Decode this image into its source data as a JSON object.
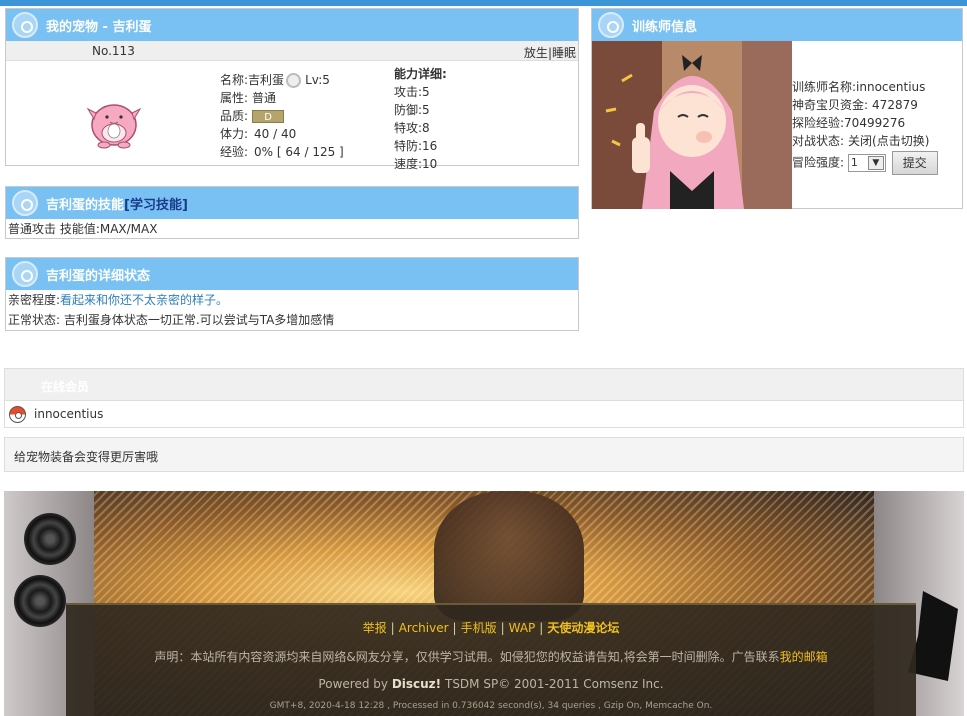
{
  "pet_panel": {
    "title": "我的宠物 - 吉利蛋",
    "number": "No.113",
    "release_label": "放生",
    "sleep_label": "睡眠",
    "separator": "|",
    "name_label": "名称:",
    "name_value": "吉利蛋",
    "level": "Lv:5",
    "type_label": "属性:",
    "type_value": "普通",
    "quality_label": "品质:",
    "quality_value": "D",
    "hp_label": "体力:",
    "hp_value": "40 / 40",
    "exp_label": "经验:",
    "exp_value": "0% [ 64 / 125 ]",
    "ability_title": "能力详细:",
    "stats": [
      "攻击:5",
      "防御:5",
      "特攻:8",
      "特防:16",
      "速度:10"
    ]
  },
  "skills_panel": {
    "title_prefix": "吉利蛋的技能",
    "learn_link": "[学习技能]",
    "content": "普通攻击 技能值:MAX/MAX"
  },
  "status_panel": {
    "title": "吉利蛋的详细状态",
    "intimacy_label": "亲密程度:",
    "intimacy_value": "看起来和你还不太亲密的样子。",
    "normal_label": "正常状态:",
    "normal_value": "吉利蛋身体状态一切正常.可以尝试与TA多增加感情"
  },
  "trainer_panel": {
    "title": "训练师信息",
    "name_label": "训练师名称:",
    "name_value": "innocentius",
    "money_label": "神奇宝贝资金:",
    "money_value": "472879",
    "exp_label": "探险经验:",
    "exp_value": "70499276",
    "battle_label": "对战状态:",
    "battle_value": "关闭(点击切换)",
    "difficulty_label": "冒险强度:",
    "difficulty_selected": "1",
    "submit_label": "提交"
  },
  "online_panel": {
    "title": "在线会员",
    "users": [
      "innocentius"
    ]
  },
  "tip": "给宠物装备会变得更厉害哦",
  "footer": {
    "links": [
      "举报",
      "Archiver",
      "手机版",
      "WAP"
    ],
    "forum_name": "天使动漫论坛",
    "declaration": "声明：本站所有内容资源均来自网络&网友分享，仅供学习试用。如侵犯您的权益请告知,将会第一时间删除。广告联系",
    "mail_link": "我的邮箱",
    "powered_prefix": "Powered by",
    "powered_brand": "Discuz!",
    "powered_suffix": "TSDM SP© 2001-2011 Comsenz Inc.",
    "stats_line": "GMT+8, 2020-4-18 12:28 , Processed in 0.736042 second(s), 34 queries , Gzip On, Memcache On."
  },
  "colors": {
    "panel_header": "#7ac1f3",
    "link": "#2d7fbd",
    "footer_link": "#f0c020"
  }
}
